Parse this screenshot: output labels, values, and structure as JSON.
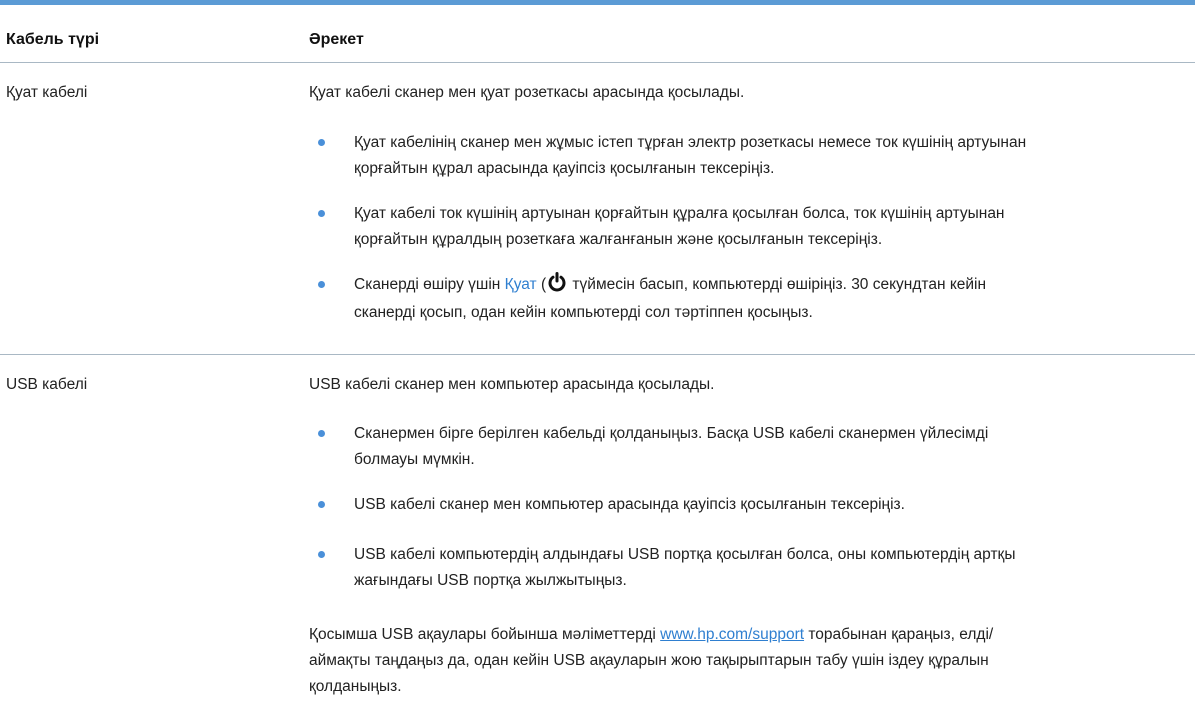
{
  "table": {
    "headers": {
      "col1": "Кабель түрі",
      "col2": "Әрекет"
    },
    "rows": [
      {
        "type": "Қуат кабелі",
        "intro": "Қуат кабелі сканер мен қуат розеткасы арасында қосылады.",
        "bullets": [
          {
            "l1": "Қуат кабелінің сканер мен жұмыс істеп тұрған электр розеткасы немесе ток күшінің артуынан",
            "l2": "қорғайтын құрал арасында қауіпсіз қосылғанын тексеріңіз."
          },
          {
            "l1": "Қуат кабелі ток күшінің артуынан қорғайтын құралға қосылған болса, ток күшінің артуынан",
            "l2": "қорғайтын құралдың розеткаға жалғанғанын және қосылғанын тексеріңіз."
          },
          {
            "l1_pre": "Сканерді өшіру үшін ",
            "l1_link": "Қуат",
            "l1_paren": " (",
            "l1_post": " түймесін басып, компьютерді өшіріңіз. 30 секундтан кейін",
            "l2": "сканерді қосып, одан кейін компьютерді сол тәртіппен қосыңыз."
          }
        ]
      },
      {
        "type": "USB кабелі",
        "intro": "USB кабелі сканер мен компьютер арасында қосылады.",
        "bullets": [
          {
            "l1": "Сканермен бірге берілген кабельді қолданыңыз. Басқа USB кабелі сканермен үйлесімді",
            "l2": "болмауы мүмкін."
          },
          {
            "l1": "USB кабелі сканер мен компьютер арасында қауіпсіз қосылғанын тексеріңіз."
          },
          {
            "l1": "USB кабелі компьютердің алдындағы USB портқа қосылған болса, оны компьютердің артқы",
            "l2": "жағындағы USB портқа жылжытыңыз."
          }
        ],
        "footer": {
          "l1_pre": "Қосымша USB ақаулары бойынша мәліметтерді ",
          "l1_link": "www.hp.com/support",
          "l1_post": " торабынан қараңыз, елді/",
          "l2": "аймақты таңдаңыз да, одан кейін USB ақауларын жою тақырыптарын табу үшін іздеу құралын",
          "l3": "қолданыңыз."
        }
      }
    ]
  },
  "icons": {
    "power": "power-icon"
  },
  "colors": {
    "accent": "#5b9bd5",
    "bullet": "#4a90d9",
    "link": "#2f7fd0"
  }
}
